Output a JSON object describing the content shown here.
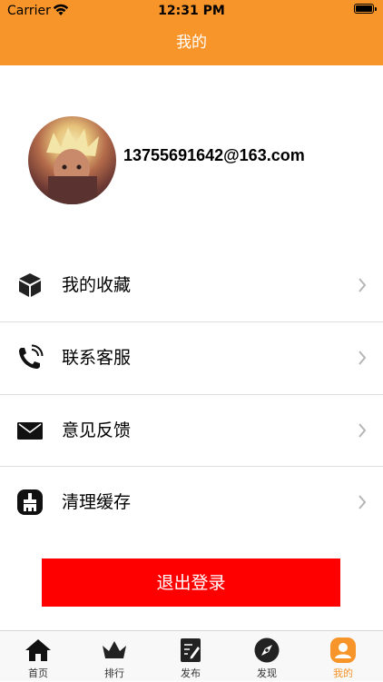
{
  "status_bar": {
    "carrier": "Carrier",
    "time": "12:31 PM"
  },
  "nav": {
    "title": "我的"
  },
  "profile": {
    "email": "13755691642@163.com"
  },
  "menu": [
    {
      "label": "我的收藏",
      "icon": "box-icon"
    },
    {
      "label": "联系客服",
      "icon": "phone-icon"
    },
    {
      "label": "意见反馈",
      "icon": "mail-icon"
    },
    {
      "label": "清理缓存",
      "icon": "broom-icon"
    }
  ],
  "logout": {
    "label": "退出登录"
  },
  "tabs": [
    {
      "label": "首页",
      "icon": "home-icon"
    },
    {
      "label": "排行",
      "icon": "crown-icon"
    },
    {
      "label": "发布",
      "icon": "edit-icon"
    },
    {
      "label": "发现",
      "icon": "compass-icon"
    },
    {
      "label": "我的",
      "icon": "user-icon",
      "active": true
    }
  ],
  "colors": {
    "accent": "#f7952a",
    "logout": "#ff0000",
    "tab_inactive": "#333333"
  }
}
